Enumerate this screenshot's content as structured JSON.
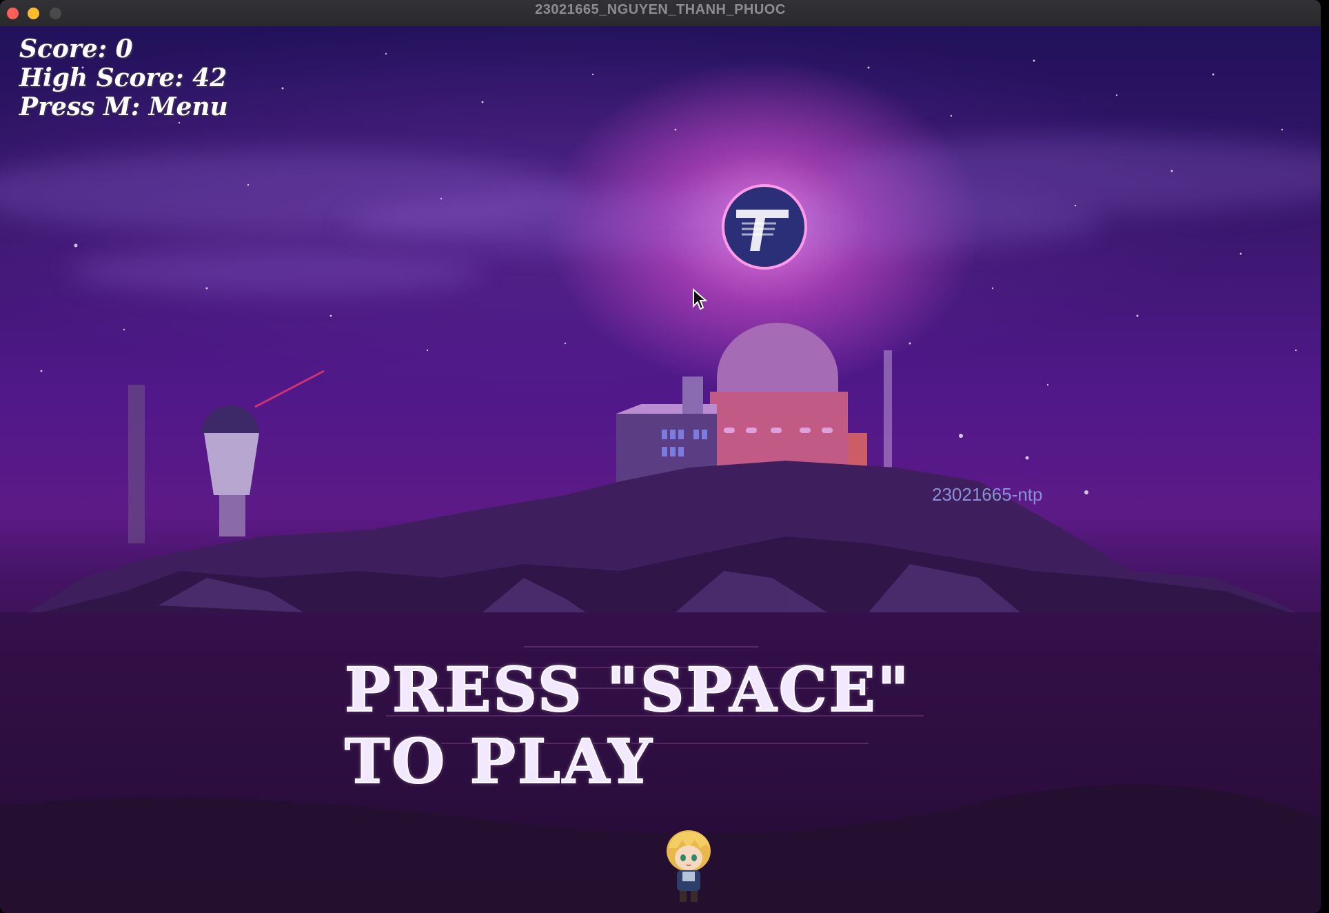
{
  "window": {
    "title": "23021665_NGUYEN_THANH_PHUOC"
  },
  "hud": {
    "score_label": "Score: 0",
    "high_score_label": "High Score: 42",
    "menu_hint": "Press M: Menu"
  },
  "prompt": {
    "text": "Press \"Space\" To Play"
  },
  "watermark": {
    "text": "23021665-ntp"
  },
  "colors": {
    "sky_top": "#21115a",
    "sky_mid": "#5c1a86",
    "water": "#2e0d3e",
    "moon_glow": "#ff8cf0",
    "traffic_close": "#ff5f57",
    "traffic_minimize": "#febc2e"
  },
  "icons": {
    "logo": "university-logo-icon",
    "cursor": "mouse-pointer-icon",
    "player": "player-character-icon"
  }
}
